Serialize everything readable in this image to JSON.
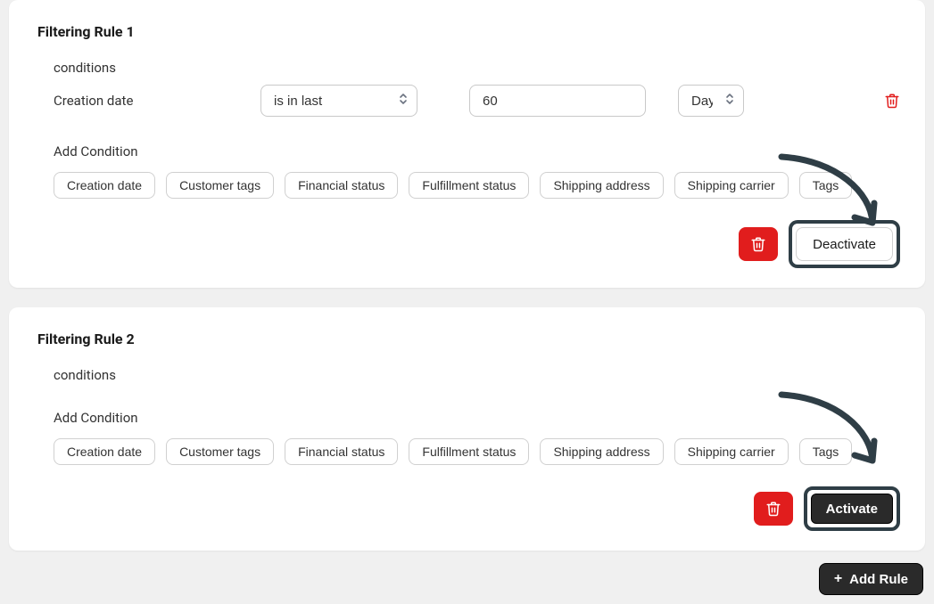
{
  "rules": [
    {
      "title": "Filtering Rule 1",
      "conditions_label": "conditions",
      "condition": {
        "field_label": "Creation date",
        "operator": "is in last",
        "value": "60",
        "unit": "Days"
      },
      "add_condition_label": "Add Condition",
      "condition_pills": [
        "Creation date",
        "Customer tags",
        "Financial status",
        "Fulfillment status",
        "Shipping address",
        "Shipping carrier",
        "Tags"
      ],
      "action_button_label": "Deactivate",
      "action_button_style": "white"
    },
    {
      "title": "Filtering Rule 2",
      "conditions_label": "conditions",
      "add_condition_label": "Add Condition",
      "condition_pills": [
        "Creation date",
        "Customer tags",
        "Financial status",
        "Fulfillment status",
        "Shipping address",
        "Shipping carrier",
        "Tags"
      ],
      "action_button_label": "Activate",
      "action_button_style": "dark"
    }
  ],
  "footer": {
    "add_rule_label": "Add Rule"
  },
  "colors": {
    "accent_red": "#e11d1d",
    "dark": "#2a2a2a",
    "highlight_border": "#2f3e46"
  }
}
